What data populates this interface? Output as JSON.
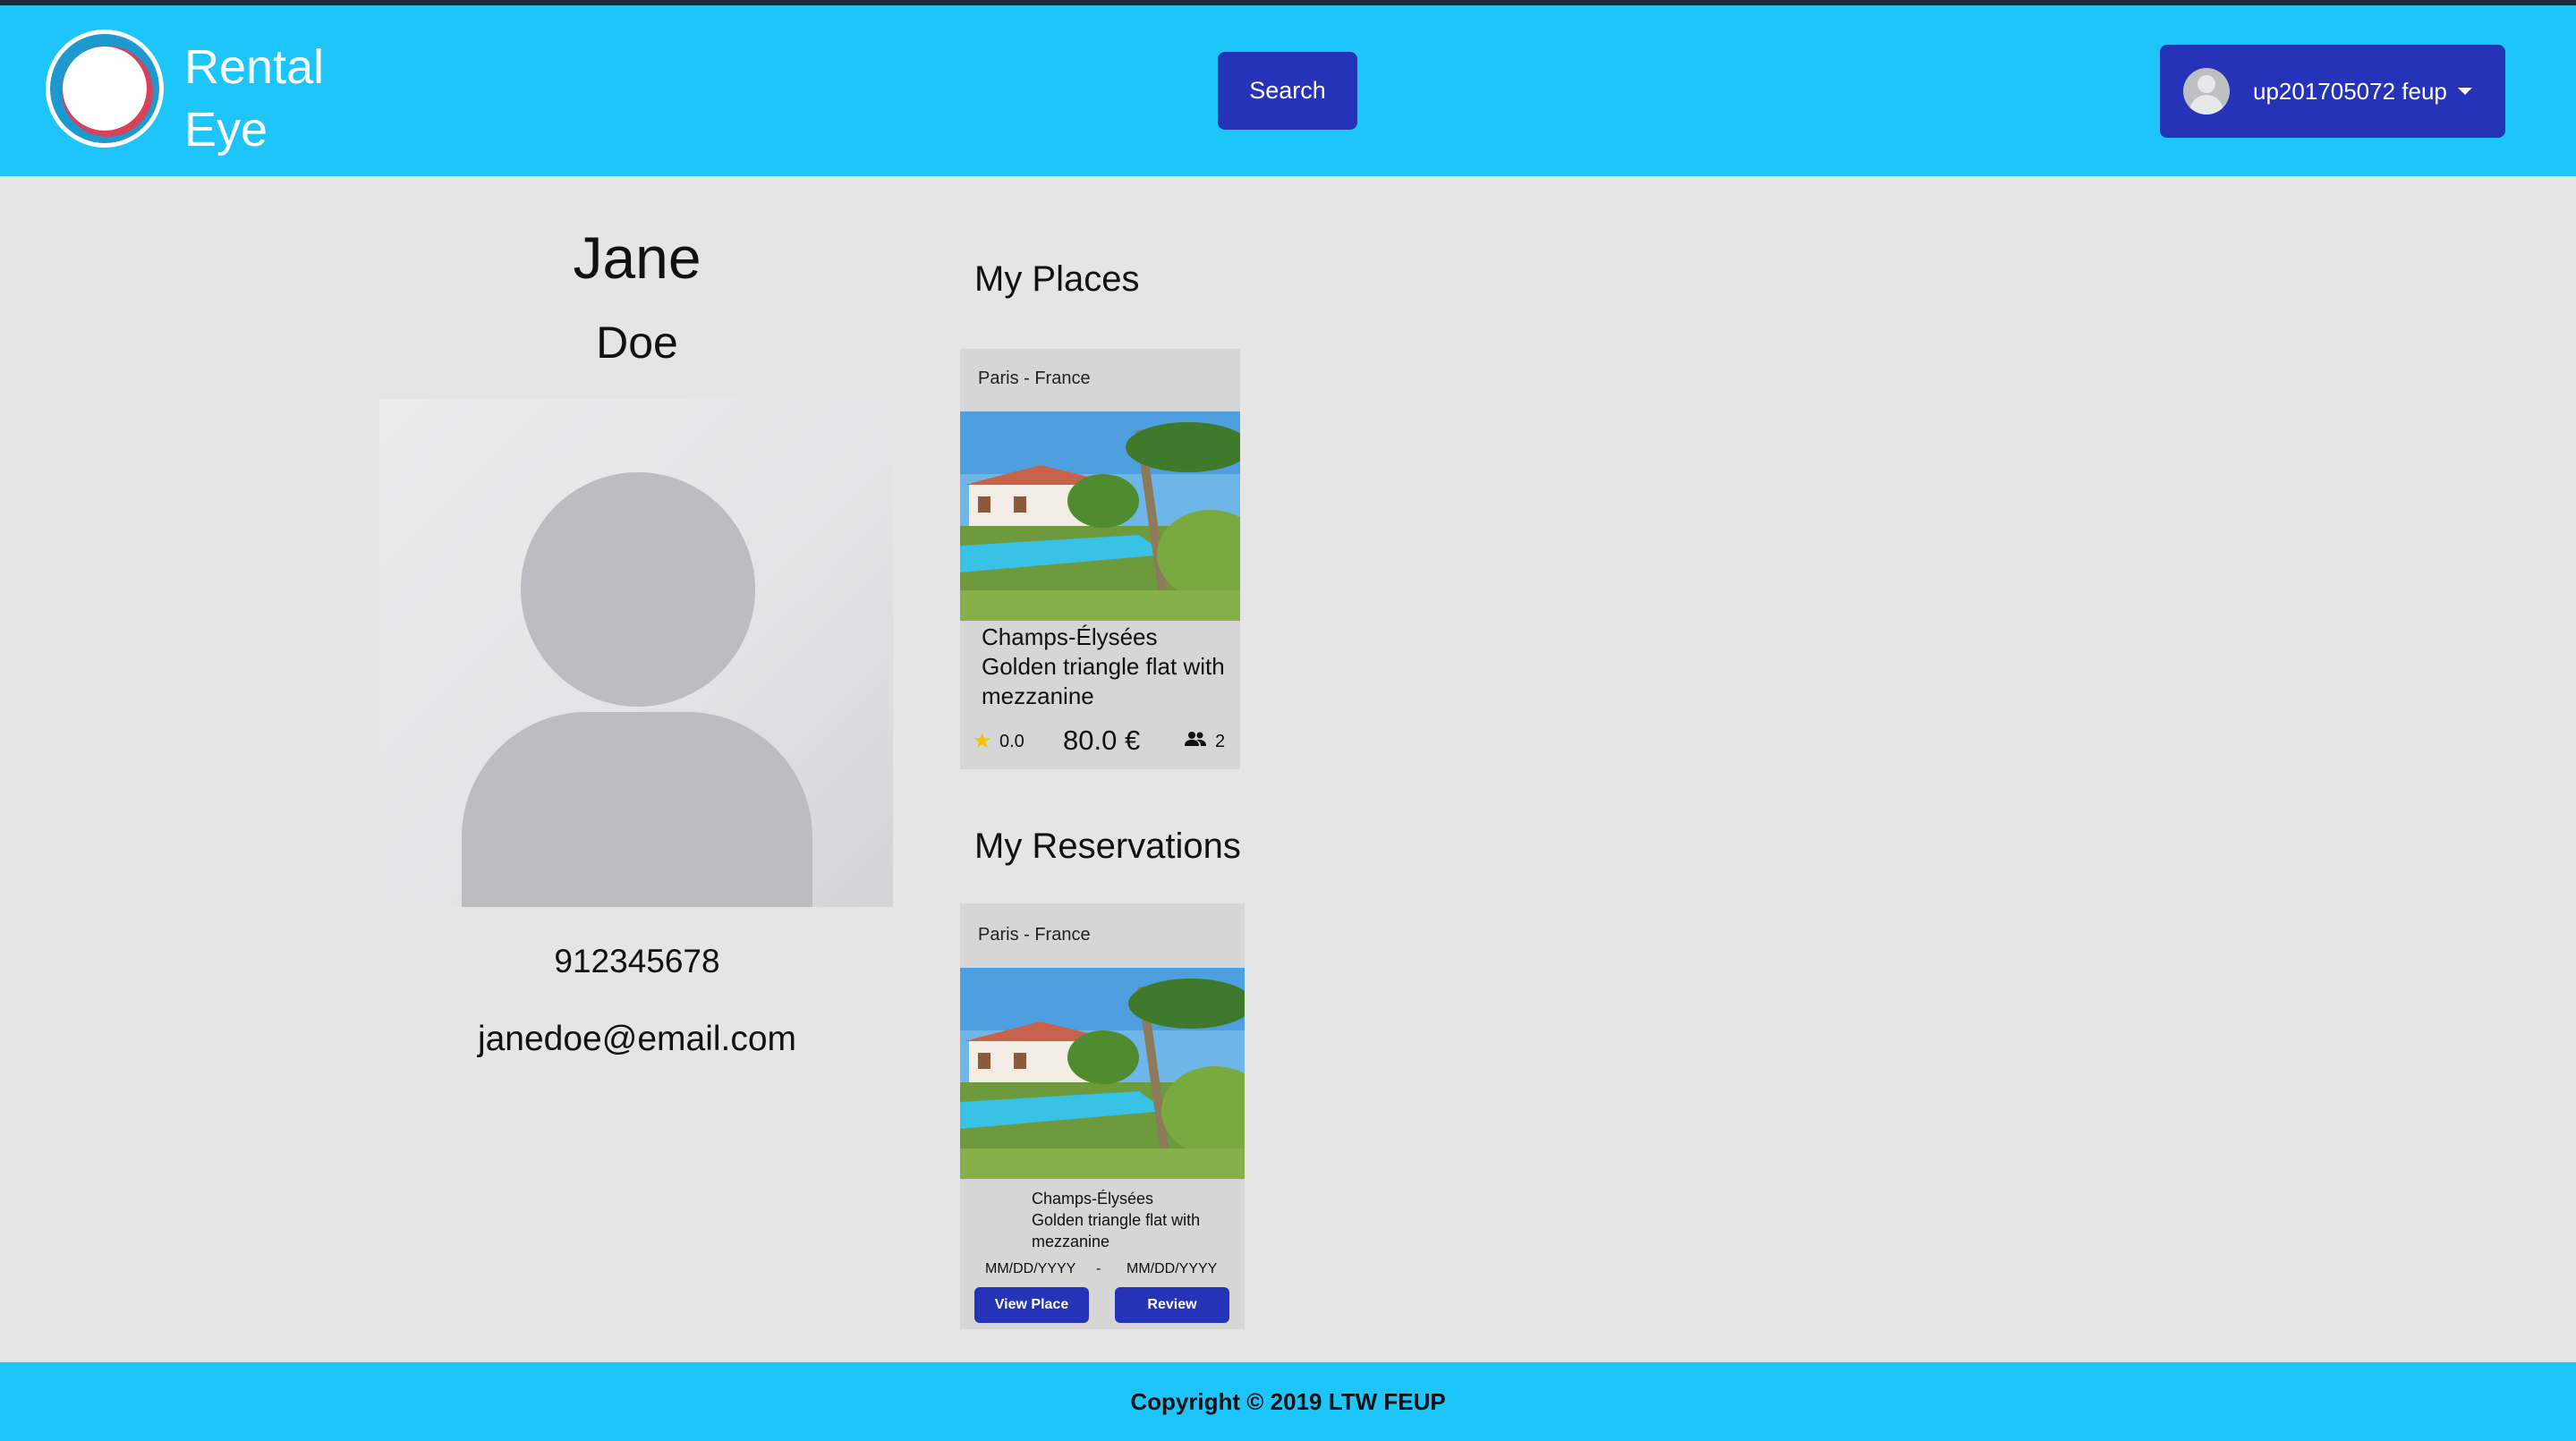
{
  "header": {
    "brand_line1": "Rental",
    "brand_line2": "Eye",
    "search_label": "Search",
    "user_label": "up201705072 feup"
  },
  "profile": {
    "first_name": "Jane",
    "last_name": "Doe",
    "phone": "912345678",
    "email": "janedoe@email.com"
  },
  "my_places": {
    "title": "My Places",
    "cards": [
      {
        "location": "Paris - France",
        "title": "Champs-Élysées Golden triangle flat with mezzanine",
        "rating": "0.0",
        "price": "80.0 €",
        "capacity": "2"
      }
    ]
  },
  "my_reservations": {
    "title": "My Reservations",
    "cards": [
      {
        "location": "Paris - France",
        "title": "Champs-Élysées Golden triangle flat with mezzanine",
        "date_from": "MM/DD/YYYY",
        "date_sep": "-",
        "date_to": "MM/DD/YYYY",
        "view_label": "View Place",
        "review_label": "Review"
      }
    ]
  },
  "footer": {
    "copyright": "Copyright © 2019 LTW FEUP"
  },
  "colors": {
    "header_bg": "#1ec5fb",
    "button_bg": "#2533b8",
    "page_bg": "#e5e5e5",
    "card_bg": "#d6d6d6",
    "star": "#f2c200"
  }
}
